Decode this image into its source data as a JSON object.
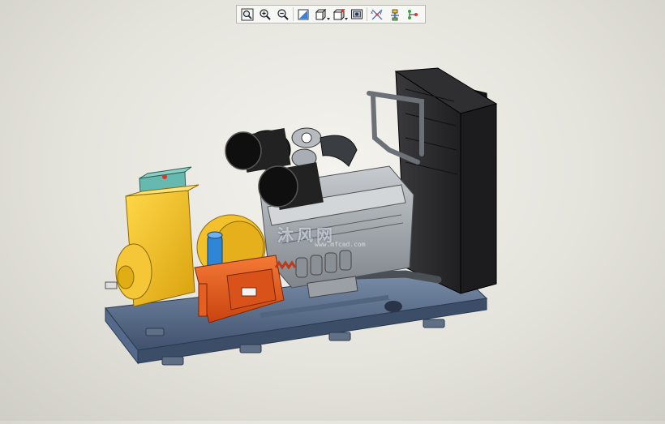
{
  "toolbar": {
    "buttons": [
      {
        "icon": "zoom-fit-icon",
        "tooltip": ""
      },
      {
        "icon": "zoom-in-icon",
        "tooltip": ""
      },
      {
        "icon": "zoom-out-icon",
        "tooltip": ""
      },
      {
        "icon": "refit-icon",
        "tooltip": ""
      },
      {
        "icon": "display-style-icon",
        "tooltip": ""
      },
      {
        "icon": "saved-views-icon",
        "tooltip": ""
      },
      {
        "icon": "snapshot-icon",
        "tooltip": ""
      },
      {
        "icon": "datum-display-icon",
        "tooltip": ""
      },
      {
        "icon": "spin-center-icon",
        "tooltip": ""
      },
      {
        "icon": "annotation-display-icon",
        "tooltip": ""
      }
    ]
  },
  "model": {
    "name": "diesel-generator-set",
    "colors": {
      "alternator": "#f2c21a",
      "base_frame": "#5a6f8e",
      "engine": "#9aa0a6",
      "radiator": "#2a2a2c",
      "control_box": "#e0561e",
      "control_panel": "#5fb3a9",
      "air_filter": "#1a1a1a",
      "coolant_tank": "#2e7fd0",
      "background": "#e8e7e0"
    }
  },
  "watermark": {
    "text": "沐风网",
    "url": "www.mfcad.com"
  }
}
